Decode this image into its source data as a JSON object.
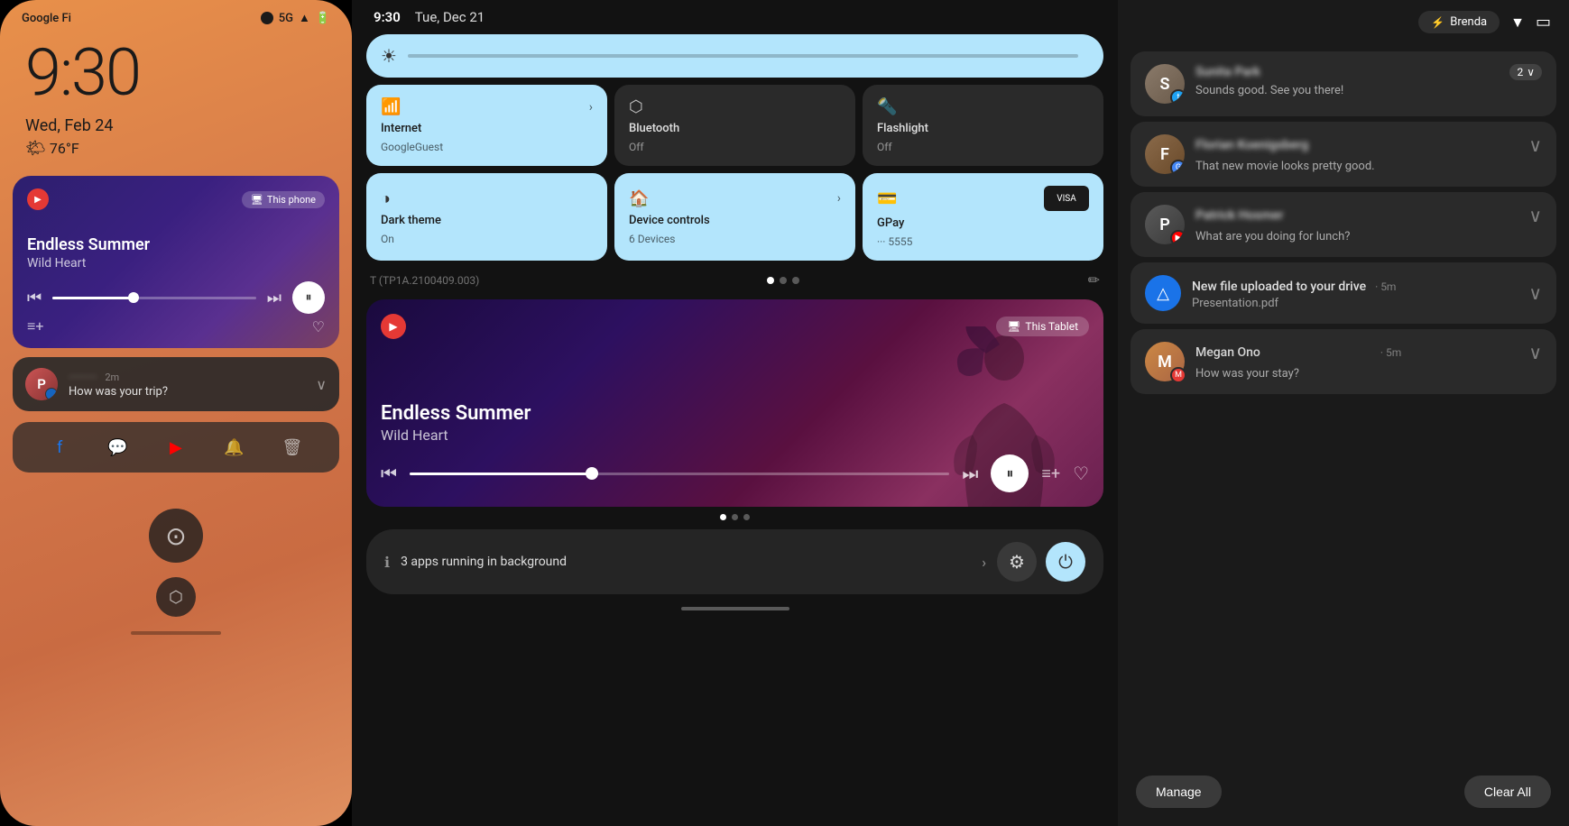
{
  "phone": {
    "carrier": "Google Fi",
    "signal": "5G",
    "time": "9:30",
    "date": "Wed, Feb 24",
    "weather": "76°F",
    "music": {
      "title": "Endless Summer",
      "artist": "Wild Heart",
      "this_device": "This phone"
    },
    "notification": {
      "name": "...",
      "time": "2m",
      "message": "How was your trip?"
    }
  },
  "tablet": {
    "time": "9:30",
    "date": "Tue, Dec 21",
    "quick_settings": {
      "internet_title": "Internet",
      "internet_subtitle": "GoogleGuest",
      "bluetooth_title": "Bluetooth",
      "bluetooth_status": "Off",
      "flashlight_title": "Flashlight",
      "flashlight_status": "Off",
      "dark_theme_title": "Dark theme",
      "dark_theme_status": "On",
      "device_controls_title": "Device controls",
      "device_controls_subtitle": "6 Devices",
      "gpay_title": "GPay",
      "gpay_subtitle": "··· 5555"
    },
    "build": "T (TP1A.2100409.003)",
    "media": {
      "title": "Endless Summer",
      "artist": "Wild Heart",
      "this_device": "This Tablet"
    },
    "bg_running": "3 apps running in background"
  },
  "notifications": {
    "header": {
      "user": "Brenda"
    },
    "items": [
      {
        "name": "Sunita Park",
        "app": "Twitter",
        "message": "Sounds good. See you there!",
        "count": "2"
      },
      {
        "name": "Florian Koenigsberg",
        "app": "Google",
        "message": "That new movie looks pretty good."
      },
      {
        "name": "Patrick Hosmer",
        "app": "YouTube",
        "message": "What are you doing for lunch?"
      },
      {
        "type": "drive",
        "title": "New file uploaded to your drive",
        "time": "5m",
        "filename": "Presentation.pdf"
      },
      {
        "name": "Megan Ono",
        "time": "5m",
        "message": "How was your stay?"
      }
    ],
    "manage_label": "Manage",
    "clear_all_label": "Clear All"
  }
}
